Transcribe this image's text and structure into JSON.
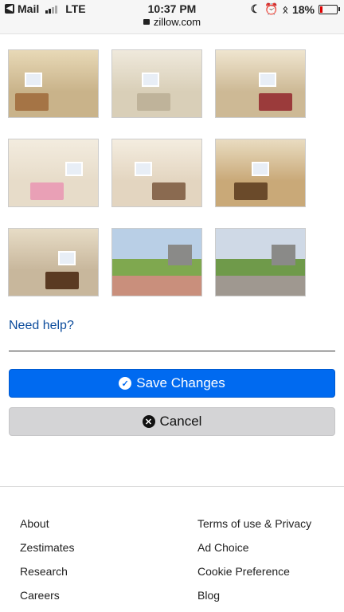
{
  "status_bar": {
    "back_app": "Mail",
    "network": "LTE",
    "time": "10:37 PM",
    "url": "zillow.com",
    "battery": "18%",
    "battery_level": 0.18
  },
  "photos": [
    {
      "label": "bathroom-vanity",
      "colors": [
        "#c9b38a",
        "#e8d9b7",
        "#a57445"
      ]
    },
    {
      "label": "bathroom-tub",
      "colors": [
        "#d9cfb8",
        "#efe9dc",
        "#bfb39a"
      ]
    },
    {
      "label": "bunk-bedroom",
      "colors": [
        "#cdb995",
        "#efe5cf",
        "#9b3b3b"
      ]
    },
    {
      "label": "girls-bedroom",
      "colors": [
        "#e7dcc9",
        "#f3ecdf",
        "#e9a0b6"
      ]
    },
    {
      "label": "playhouse-bedroom",
      "colors": [
        "#e3d5c0",
        "#f4ede0",
        "#8a6a50"
      ]
    },
    {
      "label": "basement-dining",
      "colors": [
        "#c9a978",
        "#e9dcc1",
        "#6a4a2a"
      ]
    },
    {
      "label": "basement-bar",
      "colors": [
        "#c8b79c",
        "#e7dcc6",
        "#5a3a22"
      ]
    },
    {
      "label": "patio-shed",
      "colors": [
        "#b9cfe6",
        "#7fa84f",
        "#c98f7c"
      ]
    },
    {
      "label": "patio-firepit",
      "colors": [
        "#cfd9e6",
        "#6f9a4a",
        "#9f9890"
      ]
    }
  ],
  "need_help": "Need help?",
  "save_button": "Save Changes",
  "cancel_button": "Cancel",
  "footer": {
    "left": [
      "About",
      "Zestimates",
      "Research",
      "Careers"
    ],
    "right": [
      "Terms of use & Privacy",
      "Ad Choice",
      "Cookie Preference",
      "Blog"
    ]
  },
  "icons": {
    "save": "check-circle-icon",
    "cancel": "x-circle-icon"
  },
  "colors": {
    "primary": "#006af0",
    "link": "#0c4c9c",
    "secondary_button": "#d4d4d6"
  }
}
